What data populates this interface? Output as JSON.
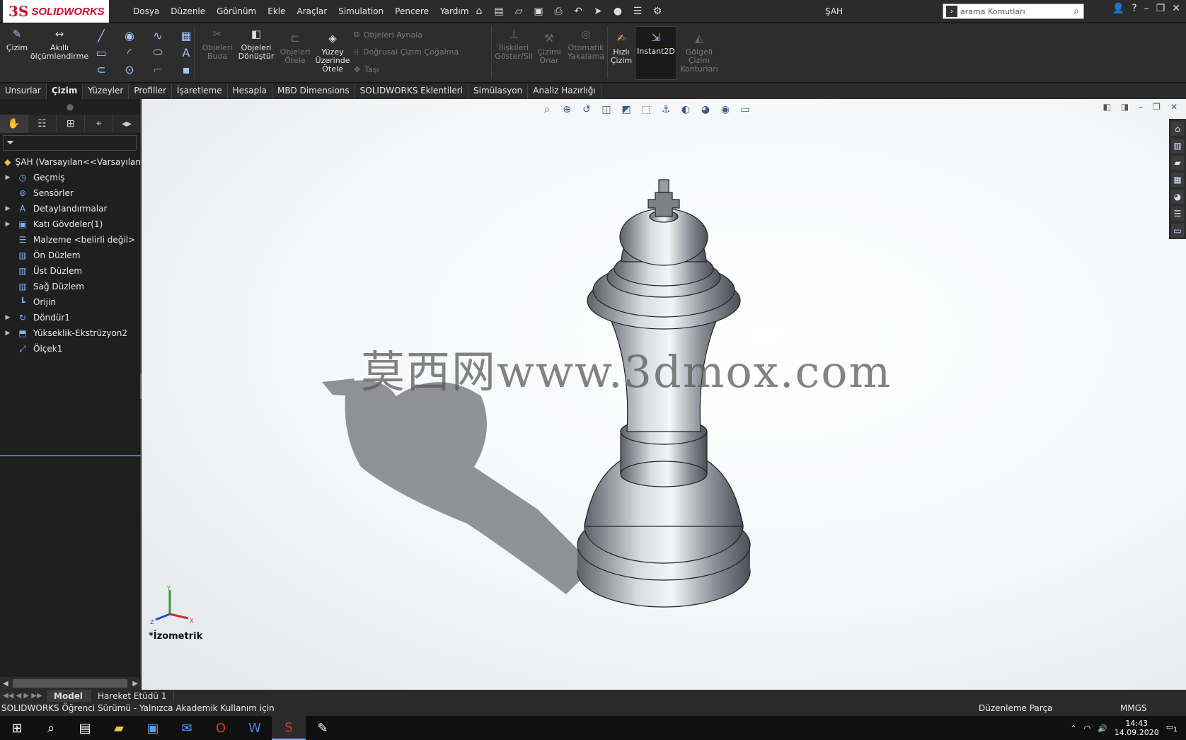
{
  "app": {
    "logo_ds": "3S",
    "logo_name": "SOLIDWORKS",
    "doc_title": "ŞAH"
  },
  "menu": [
    "Dosya",
    "Düzenle",
    "Görünüm",
    "Ekle",
    "Araçlar",
    "Simulation",
    "Pencere",
    "Yardım"
  ],
  "search": {
    "placeholder": "arama Komutları"
  },
  "ribbon": {
    "cizim": "Çizim",
    "akilli": "Akıllı ölçümlendirme",
    "buda": "Objeleri Buda",
    "donustur": "Objeleri Dönüştür",
    "otele": "Objeleri Ötele",
    "yuzey_otele": "Yüzey Üzerinde Ötele",
    "aynala": "Objeleri Aynala",
    "cogalt": "Doğrusal Çizim Çoğalma",
    "tasi": "Taşı",
    "iliskiler": "İlişkileri Göster/Sil",
    "onar": "Çizimi Onar",
    "yakala": "Otomatik Yakalama",
    "hizli": "Hızlı Çizim",
    "instant2d": "Instant2D",
    "golgeli": "Gölgeli Çizim Konturları"
  },
  "tabs": [
    "Unsurlar",
    "Çizim",
    "Yüzeyler",
    "Profiller",
    "İşaretleme",
    "Hesapla",
    "MBD Dimensions",
    "SOLIDWORKS Eklentileri",
    "Simülasyon",
    "Analiz Hazırlığı"
  ],
  "active_tab": "Çizim",
  "tree": [
    {
      "label": "ŞAH  (Varsayılan<<Varsayılan",
      "expandable": false,
      "icon": "part-icon"
    },
    {
      "label": "Geçmiş",
      "expandable": true,
      "icon": "history-icon"
    },
    {
      "label": "Sensörler",
      "expandable": false,
      "icon": "sensor-icon"
    },
    {
      "label": "Detaylandırmalar",
      "expandable": true,
      "icon": "annotation-icon"
    },
    {
      "label": "Katı Gövdeler(1)",
      "expandable": true,
      "icon": "solid-body-icon"
    },
    {
      "label": "Malzeme <belirli değil>",
      "expandable": false,
      "icon": "material-icon"
    },
    {
      "label": "Ön Düzlem",
      "expandable": false,
      "icon": "plane-icon"
    },
    {
      "label": "Üst Düzlem",
      "expandable": false,
      "icon": "plane-icon"
    },
    {
      "label": "Sağ Düzlem",
      "expandable": false,
      "icon": "plane-icon"
    },
    {
      "label": "Orijin",
      "expandable": false,
      "icon": "origin-icon"
    },
    {
      "label": "Döndür1",
      "expandable": true,
      "icon": "revolve-icon"
    },
    {
      "label": "Yükseklik-Ekstrüzyon2",
      "expandable": true,
      "icon": "extrude-icon"
    },
    {
      "label": "Ölçek1",
      "expandable": false,
      "icon": "scale-icon"
    }
  ],
  "viewport": {
    "watermark": "莫西网www.3dmox.com",
    "orientation": "*İzometrik",
    "axis_x": "X",
    "axis_y": "Y",
    "axis_z": "Z"
  },
  "model_tabs": [
    "Model",
    "Hareket Etüdü 1"
  ],
  "status": {
    "left": "SOLIDWORKS Öğrenci Sürümü - Yalnızca Akademik Kullanım için",
    "mode": "Düzenleme Parça",
    "units": "MMGS"
  },
  "taskbar": {
    "time": "14:43",
    "date": "14.09.2020",
    "notif": "1"
  }
}
